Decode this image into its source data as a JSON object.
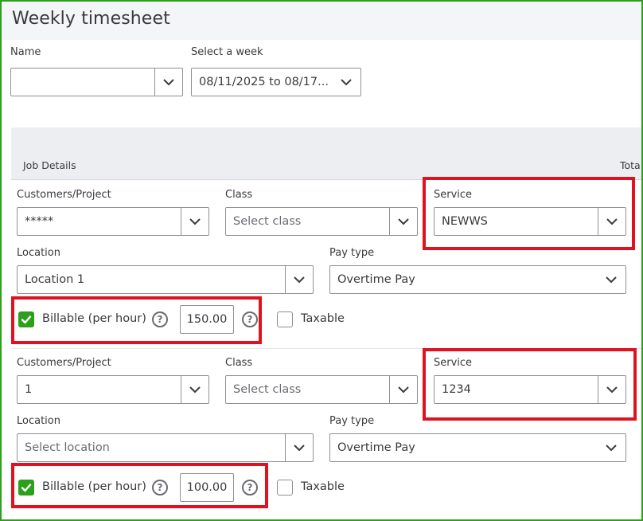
{
  "page": {
    "title": "Weekly timesheet",
    "name_label": "Name",
    "name_value": "",
    "week_label": "Select a week",
    "week_value": "08/11/2025 to 08/17...",
    "job_details": "Job Details",
    "total_label": "Tota"
  },
  "entries": [
    {
      "customer_label": "Customers/Project",
      "customer_value": "*****",
      "class_label": "Class",
      "class_placeholder": "Select class",
      "service_label": "Service",
      "service_value": "NEWWS",
      "location_label": "Location",
      "location_value": "Location 1",
      "paytype_label": "Pay type",
      "paytype_value": "Overtime Pay",
      "billable_label": "Billable (per hour)",
      "billable_checked": true,
      "rate": "150.00",
      "taxable_label": "Taxable",
      "taxable_checked": false
    },
    {
      "customer_label": "Customers/Project",
      "customer_value": "1",
      "class_label": "Class",
      "class_placeholder": "Select class",
      "service_label": "Service",
      "service_value": "1234",
      "location_label": "Location",
      "location_value": "Select location",
      "paytype_label": "Pay type",
      "paytype_value": "Overtime Pay",
      "billable_label": "Billable (per hour)",
      "billable_checked": true,
      "rate": "100.00",
      "taxable_label": "Taxable",
      "taxable_checked": false
    }
  ],
  "icons": {
    "help": "?",
    "dropdown": "chevron-down-icon",
    "check": "checkmark-icon"
  },
  "colors": {
    "frame_border": "#2ca01c",
    "highlight_box": "#e0121f",
    "checkbox_checked": "#2ca01c",
    "header_bg": "#f4f5f8"
  }
}
